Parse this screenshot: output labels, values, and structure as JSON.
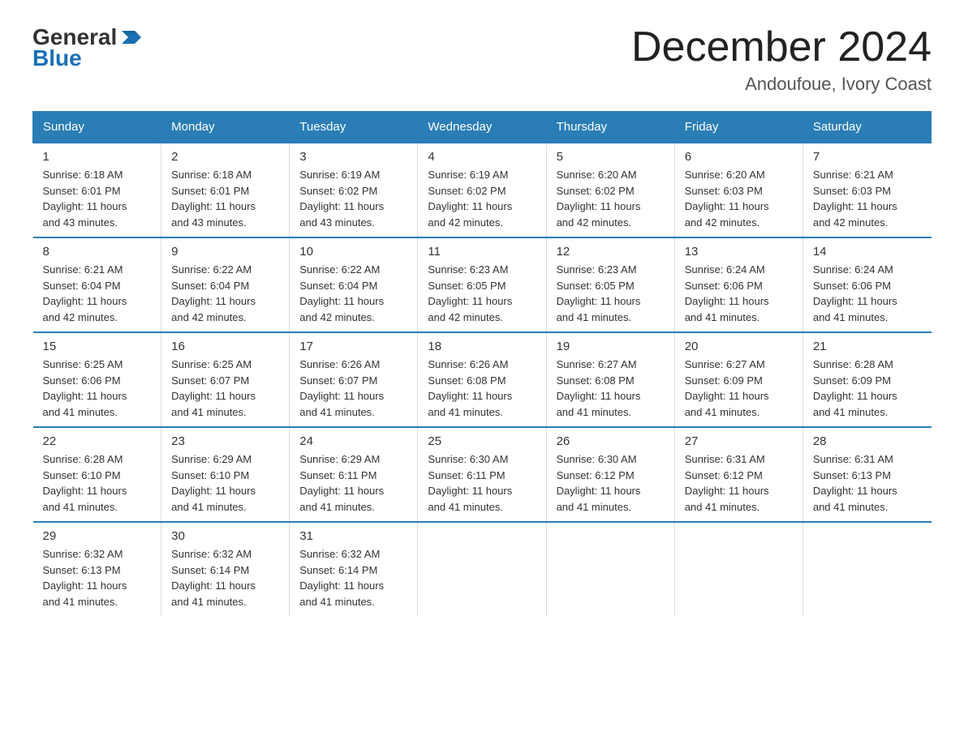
{
  "logo": {
    "general": "General",
    "blue": "Blue"
  },
  "title": "December 2024",
  "subtitle": "Andoufoue, Ivory Coast",
  "weekdays": [
    "Sunday",
    "Monday",
    "Tuesday",
    "Wednesday",
    "Thursday",
    "Friday",
    "Saturday"
  ],
  "weeks": [
    [
      {
        "day": "1",
        "sunrise": "6:18 AM",
        "sunset": "6:01 PM",
        "daylight": "11 hours and 43 minutes."
      },
      {
        "day": "2",
        "sunrise": "6:18 AM",
        "sunset": "6:01 PM",
        "daylight": "11 hours and 43 minutes."
      },
      {
        "day": "3",
        "sunrise": "6:19 AM",
        "sunset": "6:02 PM",
        "daylight": "11 hours and 43 minutes."
      },
      {
        "day": "4",
        "sunrise": "6:19 AM",
        "sunset": "6:02 PM",
        "daylight": "11 hours and 42 minutes."
      },
      {
        "day": "5",
        "sunrise": "6:20 AM",
        "sunset": "6:02 PM",
        "daylight": "11 hours and 42 minutes."
      },
      {
        "day": "6",
        "sunrise": "6:20 AM",
        "sunset": "6:03 PM",
        "daylight": "11 hours and 42 minutes."
      },
      {
        "day": "7",
        "sunrise": "6:21 AM",
        "sunset": "6:03 PM",
        "daylight": "11 hours and 42 minutes."
      }
    ],
    [
      {
        "day": "8",
        "sunrise": "6:21 AM",
        "sunset": "6:04 PM",
        "daylight": "11 hours and 42 minutes."
      },
      {
        "day": "9",
        "sunrise": "6:22 AM",
        "sunset": "6:04 PM",
        "daylight": "11 hours and 42 minutes."
      },
      {
        "day": "10",
        "sunrise": "6:22 AM",
        "sunset": "6:04 PM",
        "daylight": "11 hours and 42 minutes."
      },
      {
        "day": "11",
        "sunrise": "6:23 AM",
        "sunset": "6:05 PM",
        "daylight": "11 hours and 42 minutes."
      },
      {
        "day": "12",
        "sunrise": "6:23 AM",
        "sunset": "6:05 PM",
        "daylight": "11 hours and 41 minutes."
      },
      {
        "day": "13",
        "sunrise": "6:24 AM",
        "sunset": "6:06 PM",
        "daylight": "11 hours and 41 minutes."
      },
      {
        "day": "14",
        "sunrise": "6:24 AM",
        "sunset": "6:06 PM",
        "daylight": "11 hours and 41 minutes."
      }
    ],
    [
      {
        "day": "15",
        "sunrise": "6:25 AM",
        "sunset": "6:06 PM",
        "daylight": "11 hours and 41 minutes."
      },
      {
        "day": "16",
        "sunrise": "6:25 AM",
        "sunset": "6:07 PM",
        "daylight": "11 hours and 41 minutes."
      },
      {
        "day": "17",
        "sunrise": "6:26 AM",
        "sunset": "6:07 PM",
        "daylight": "11 hours and 41 minutes."
      },
      {
        "day": "18",
        "sunrise": "6:26 AM",
        "sunset": "6:08 PM",
        "daylight": "11 hours and 41 minutes."
      },
      {
        "day": "19",
        "sunrise": "6:27 AM",
        "sunset": "6:08 PM",
        "daylight": "11 hours and 41 minutes."
      },
      {
        "day": "20",
        "sunrise": "6:27 AM",
        "sunset": "6:09 PM",
        "daylight": "11 hours and 41 minutes."
      },
      {
        "day": "21",
        "sunrise": "6:28 AM",
        "sunset": "6:09 PM",
        "daylight": "11 hours and 41 minutes."
      }
    ],
    [
      {
        "day": "22",
        "sunrise": "6:28 AM",
        "sunset": "6:10 PM",
        "daylight": "11 hours and 41 minutes."
      },
      {
        "day": "23",
        "sunrise": "6:29 AM",
        "sunset": "6:10 PM",
        "daylight": "11 hours and 41 minutes."
      },
      {
        "day": "24",
        "sunrise": "6:29 AM",
        "sunset": "6:11 PM",
        "daylight": "11 hours and 41 minutes."
      },
      {
        "day": "25",
        "sunrise": "6:30 AM",
        "sunset": "6:11 PM",
        "daylight": "11 hours and 41 minutes."
      },
      {
        "day": "26",
        "sunrise": "6:30 AM",
        "sunset": "6:12 PM",
        "daylight": "11 hours and 41 minutes."
      },
      {
        "day": "27",
        "sunrise": "6:31 AM",
        "sunset": "6:12 PM",
        "daylight": "11 hours and 41 minutes."
      },
      {
        "day": "28",
        "sunrise": "6:31 AM",
        "sunset": "6:13 PM",
        "daylight": "11 hours and 41 minutes."
      }
    ],
    [
      {
        "day": "29",
        "sunrise": "6:32 AM",
        "sunset": "6:13 PM",
        "daylight": "11 hours and 41 minutes."
      },
      {
        "day": "30",
        "sunrise": "6:32 AM",
        "sunset": "6:14 PM",
        "daylight": "11 hours and 41 minutes."
      },
      {
        "day": "31",
        "sunrise": "6:32 AM",
        "sunset": "6:14 PM",
        "daylight": "11 hours and 41 minutes."
      },
      null,
      null,
      null,
      null
    ]
  ],
  "labels": {
    "sunrise": "Sunrise:",
    "sunset": "Sunset:",
    "daylight": "Daylight:"
  },
  "accent_color": "#2a7db5"
}
